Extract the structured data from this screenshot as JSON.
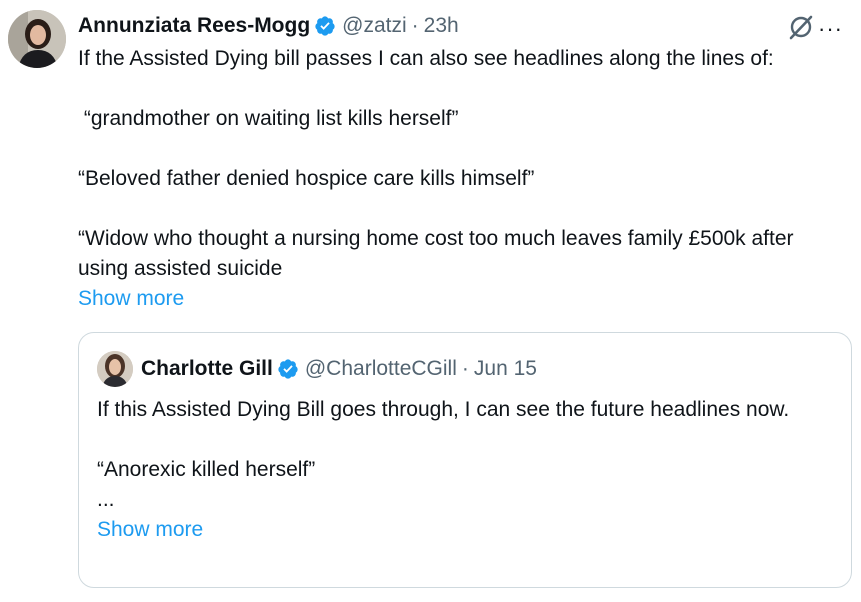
{
  "tweet": {
    "author_name": "Annunziata Rees-Mogg",
    "handle": "@zatzi",
    "separator": "·",
    "time": "23h",
    "more_label": "···",
    "paragraphs": [
      "If the Assisted Dying bill passes I can also see headlines along the lines of:",
      " “grandmother on waiting list kills herself”",
      "“Beloved father denied hospice care kills himself”",
      "“Widow who thought a nursing home cost too much leaves family £500k after using assisted suicide"
    ],
    "show_more": "Show more"
  },
  "quoted_tweet": {
    "author_name": "Charlotte Gill",
    "handle": "@CharlotteCGill",
    "separator": "·",
    "time": "Jun 15",
    "paragraphs": [
      "If this Assisted Dying Bill goes through, I can see the future headlines now.",
      "“Anorexic killed herself”",
      "..."
    ],
    "show_more": "Show more"
  },
  "colors": {
    "text": "#0f1419",
    "secondary": "#536471",
    "link": "#1d9bf0",
    "verified_badge": "#1d9bf0",
    "border": "#cfd9de"
  },
  "icons": [
    "verified-badge-icon",
    "grok-icon",
    "more-options-icon"
  ]
}
